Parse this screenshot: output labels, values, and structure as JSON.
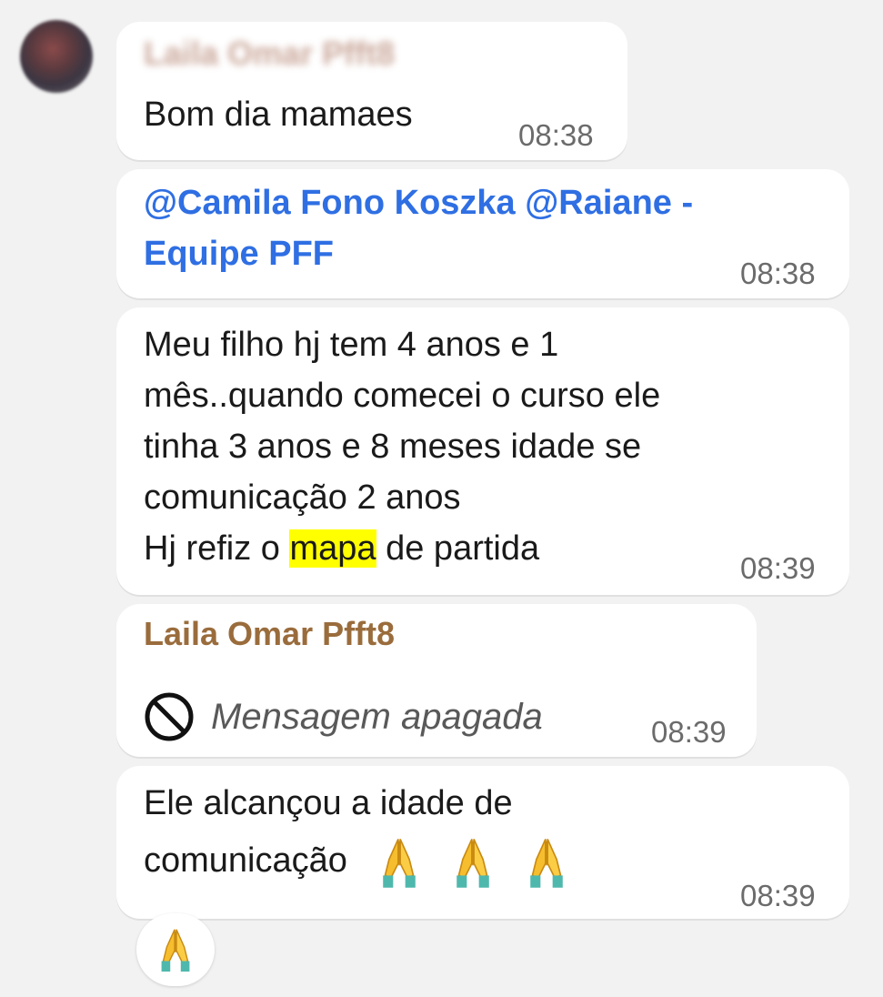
{
  "messages": [
    {
      "sender": "Laila Omar Pfft8",
      "text": "Bom dia mamaes",
      "time": "08:38"
    },
    {
      "text_line1": "@Camila Fono Koszka @Raiane -",
      "text_line2": "Equipe PFF",
      "time": "08:38"
    },
    {
      "lines": [
        "Meu filho hj tem 4 anos e 1",
        "mês..quando comecei o curso ele",
        "tinha 3 anos e 8 meses idade se",
        "comunicação 2 anos"
      ],
      "last_before": "Hj refiz o ",
      "highlight": "mapa",
      "last_after": " de partida",
      "time": "08:39"
    },
    {
      "sender": "Laila Omar Pfft8",
      "deleted": "Mensagem apagada",
      "time": "08:39"
    },
    {
      "line1": "Ele alcançou a idade de",
      "line2": "comunicação",
      "time": "08:39"
    }
  ],
  "icons": {
    "deleted": "no-entry-icon",
    "emoji": "folded-hands-emoji",
    "reaction": "folded-hands-emoji"
  },
  "colors": {
    "mention": "#2f6fe3",
    "sender": "#9a6c3c",
    "highlight": "#ffff00"
  }
}
